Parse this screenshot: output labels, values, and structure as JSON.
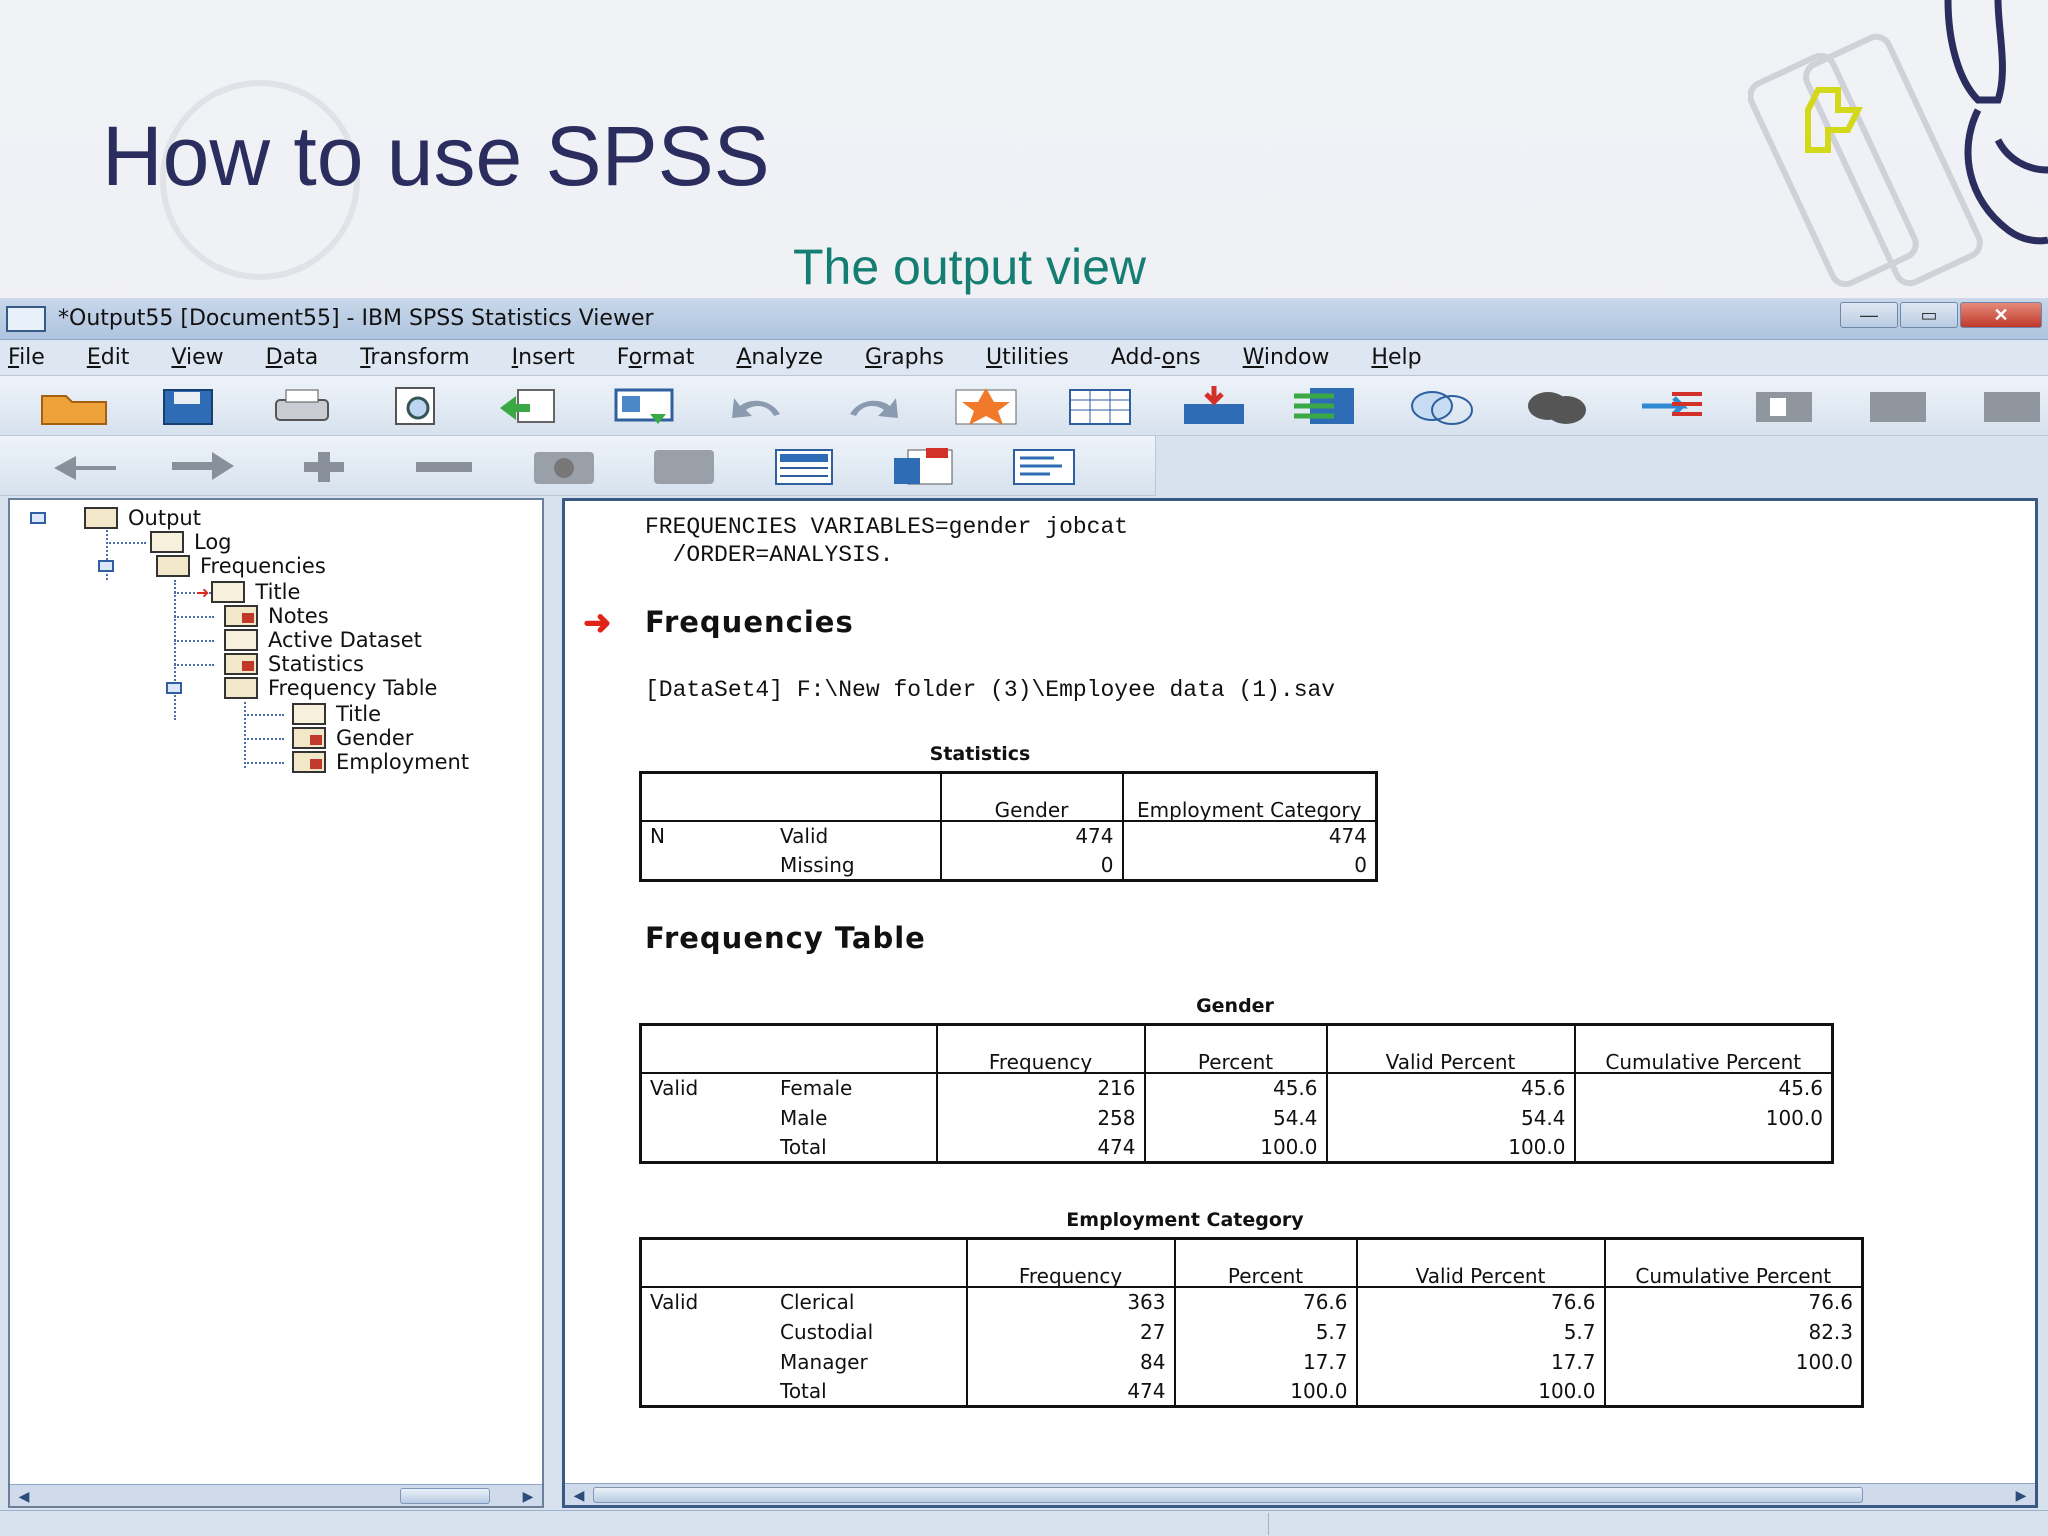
{
  "slide": {
    "title": "How to use SPSS",
    "subtitle": "The output view"
  },
  "window": {
    "title": "*Output55 [Document55] - IBM SPSS Statistics Viewer",
    "buttons": {
      "minimize": "—",
      "restore": "▭",
      "close": "✕"
    }
  },
  "menu": [
    {
      "label": "File",
      "key": "F",
      "rest": "ile"
    },
    {
      "label": "Edit",
      "key": "E",
      "rest": "dit"
    },
    {
      "label": "View",
      "key": "V",
      "rest": "iew"
    },
    {
      "label": "Data",
      "key": "D",
      "rest": "ata"
    },
    {
      "label": "Transform",
      "key": "T",
      "rest": "ransform"
    },
    {
      "label": "Insert",
      "key": "I",
      "rest": "nsert"
    },
    {
      "label": "Format",
      "key": "o",
      "pre": "F",
      "rest": "rmat"
    },
    {
      "label": "Analyze",
      "key": "A",
      "rest": "nalyze"
    },
    {
      "label": "Graphs",
      "key": "G",
      "rest": "raphs"
    },
    {
      "label": "Utilities",
      "key": "U",
      "rest": "tilities"
    },
    {
      "label": "Add-ons",
      "pre": "Add-",
      "key": "o",
      "rest": "ns"
    },
    {
      "label": "Window",
      "key": "W",
      "rest": "indow"
    },
    {
      "label": "Help",
      "key": "H",
      "rest": "elp"
    }
  ],
  "toolbar1_icons": [
    "open-folder-icon",
    "save-icon",
    "print-icon",
    "print-preview-icon",
    "export-icon",
    "recall-dialog-icon",
    "undo-icon",
    "redo-icon",
    "goto-data-icon",
    "goto-case-icon",
    "goto-variable-icon",
    "variables-icon",
    "insert-cases-icon",
    "split-file-icon",
    "weight-cases-icon",
    "select-cases-icon",
    "value-labels-icon",
    "use-sets-icon",
    "designate-window-icon"
  ],
  "toolbar2_icons": [
    "promote-icon",
    "demote-icon",
    "expand-icon",
    "collapse-icon",
    "show-icon",
    "hide-icon",
    "insert-heading-icon",
    "insert-title-icon",
    "insert-text-icon"
  ],
  "tree": {
    "output": "Output",
    "log": "Log",
    "frequencies": "Frequencies",
    "title": "Title",
    "notes": "Notes",
    "active_dataset": "Active Dataset",
    "statistics": "Statistics",
    "frequency_table": "Frequency Table",
    "ft_title": "Title",
    "gender": "Gender",
    "employment": "Employment"
  },
  "output": {
    "syntax_line1": "FREQUENCIES VARIABLES=gender jobcat",
    "syntax_line2": "  /ORDER=ANALYSIS.",
    "heading_frequencies": "Frequencies",
    "dataset_line": "[DataSet4] F:\\New folder (3)\\Employee data (1).sav",
    "stats_caption": "Statistics",
    "stats_headers": [
      "Gender",
      "Employment Category"
    ],
    "stats_rows": [
      {
        "c1": "N",
        "c2": "Valid",
        "v1": "474",
        "v2": "474"
      },
      {
        "c1": "",
        "c2": "Missing",
        "v1": "0",
        "v2": "0"
      }
    ],
    "heading_freq_table": "Frequency Table",
    "gender_caption": "Gender",
    "freq_headers": [
      "Frequency",
      "Percent",
      "Valid Percent",
      "Cumulative Percent"
    ],
    "gender_rows": [
      {
        "c1": "Valid",
        "c2": "Female",
        "f": "216",
        "p": "45.6",
        "vp": "45.6",
        "cp": "45.6"
      },
      {
        "c1": "",
        "c2": "Male",
        "f": "258",
        "p": "54.4",
        "vp": "54.4",
        "cp": "100.0"
      },
      {
        "c1": "",
        "c2": "Total",
        "f": "474",
        "p": "100.0",
        "vp": "100.0",
        "cp": ""
      }
    ],
    "emp_caption": "Employment Category",
    "emp_rows": [
      {
        "c1": "Valid",
        "c2": "Clerical",
        "f": "363",
        "p": "76.6",
        "vp": "76.6",
        "cp": "76.6"
      },
      {
        "c1": "",
        "c2": "Custodial",
        "f": "27",
        "p": "5.7",
        "vp": "5.7",
        "cp": "82.3"
      },
      {
        "c1": "",
        "c2": "Manager",
        "f": "84",
        "p": "17.7",
        "vp": "17.7",
        "cp": "100.0"
      },
      {
        "c1": "",
        "c2": "Total",
        "f": "474",
        "p": "100.0",
        "vp": "100.0",
        "cp": ""
      }
    ]
  }
}
